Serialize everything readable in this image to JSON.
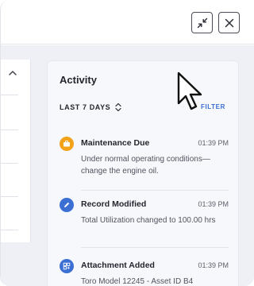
{
  "window_controls": {
    "minimize_icon": "collapse-arrows-icon",
    "close_icon": "close-x-icon"
  },
  "activity": {
    "title": "Activity",
    "range_label": "LAST 7 DAYS",
    "filter_label": "FILTER",
    "items": [
      {
        "icon": "briefcase-icon",
        "icon_color": "#f2a21b",
        "title": "Maintenance Due",
        "time": "01:39 PM",
        "description": "Under normal operating conditions—change the engine oil."
      },
      {
        "icon": "pencil-icon",
        "icon_color": "#3b6fd4",
        "title": "Record Modified",
        "time": "01:39 PM",
        "description": "Total Utilization changed to 100.00 hrs"
      },
      {
        "icon": "attachment-grid-icon",
        "icon_color": "#3b6fd4",
        "title": "Attachment Added",
        "time": "01:39 PM",
        "description": "Toro Model 12245 - Asset ID B4"
      }
    ]
  }
}
